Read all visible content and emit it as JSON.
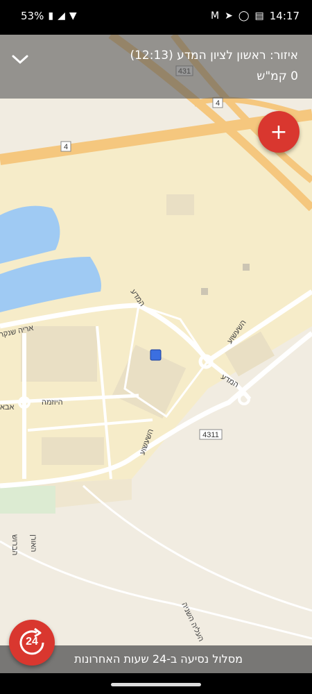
{
  "status_bar": {
    "battery": "53%",
    "time": "14:17",
    "icons": [
      "battery-icon",
      "signal-icon",
      "wifi-icon",
      "gmail-icon",
      "telegram-icon",
      "whatsapp-icon",
      "message-icon"
    ]
  },
  "header": {
    "zone_text": "איזור: ראשון לציון המדע (12:13)",
    "speed_text": "0 קמ\"ש",
    "collapse_icon": "chevron-down-icon"
  },
  "fab": {
    "icon": "plus-icon",
    "label": "+"
  },
  "map": {
    "road_shields": [
      "431",
      "4",
      "4",
      "4311"
    ],
    "street_labels": [
      "המדע",
      "המדע",
      "השעשוע",
      "השעשוע",
      "אריה שנקר",
      "היוזמה",
      "אבא",
      "האורן",
      "הברוש",
      "העליה השניה"
    ],
    "marker_color": "#3b6fe0"
  },
  "history": {
    "badge": "24",
    "route_text": "מסלול נסיעה ב-24 שעות האחרונות"
  },
  "colors": {
    "accent": "#d9372f",
    "water": "#9fcaf3",
    "road": "#f5c77e"
  }
}
